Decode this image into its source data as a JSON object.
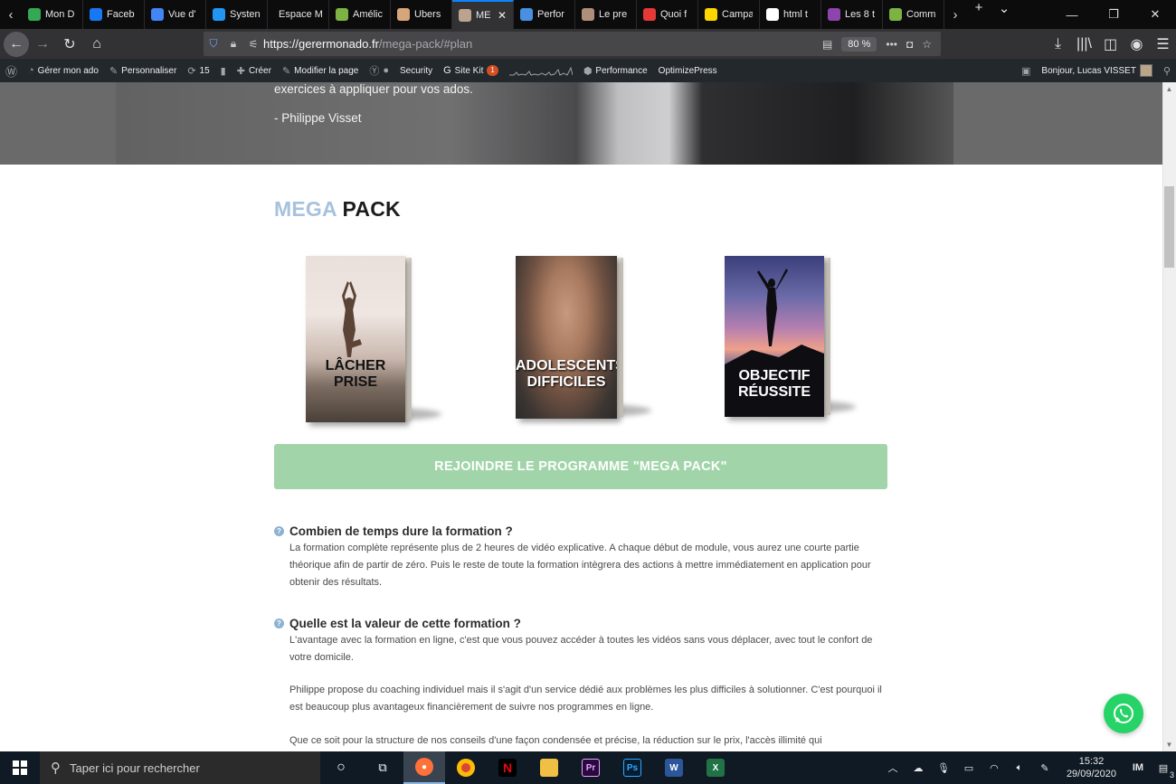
{
  "browser": {
    "tabs": [
      {
        "label": "Mon D",
        "color": "#34a853"
      },
      {
        "label": "Faceb",
        "color": "#1877f2"
      },
      {
        "label": "Vue d'",
        "color": "#4285f4"
      },
      {
        "label": "Systen",
        "color": "#2196f3"
      },
      {
        "label": "Espace Me",
        "color": ""
      },
      {
        "label": "Amélic",
        "color": "#7cb342"
      },
      {
        "label": "Ubers",
        "color": "#d7a57a"
      },
      {
        "label": "ME",
        "color": "#bba390"
      },
      {
        "label": "Perfor",
        "color": "#4a90e2"
      },
      {
        "label": "Le pre",
        "color": "#b08f7a"
      },
      {
        "label": "Quoi f",
        "color": "#e53935"
      },
      {
        "label": "Campa",
        "color": "#ffd600"
      },
      {
        "label": "html t",
        "color": "#ffffff"
      },
      {
        "label": "Les 8 t",
        "color": "#8e44ad"
      },
      {
        "label": "Comm",
        "color": "#7cb342"
      }
    ],
    "url_host": "https://gerermonado.fr",
    "url_path": "/mega-pack/#plan",
    "zoom": "80 %"
  },
  "wpbar": {
    "site": "Gérer mon ado",
    "customize": "Personnaliser",
    "updates": "15",
    "new": "Créer",
    "edit": "Modifier la page",
    "security": "Security",
    "sitekit": "Site Kit",
    "sitekit_badge": "1",
    "performance": "Performance",
    "optimizepress": "OptimizePress",
    "greeting": "Bonjour, Lucas VISSET"
  },
  "hero": {
    "line1": "exercices à appliquer pour vos ados.",
    "author": "- Philippe Visset"
  },
  "section": {
    "title_part1": "MEGA",
    "title_part2": "PACK"
  },
  "books": [
    {
      "title_l1": "LÂCHER",
      "title_l2": "PRISE"
    },
    {
      "title_l1": "ADOLESCENTS",
      "title_l2": "DIFFICILES"
    },
    {
      "title_l1": "OBJECTIF",
      "title_l2": "RÉUSSITE"
    }
  ],
  "cta": {
    "label": "REJOINDRE LE PROGRAMME \"MEGA PACK\""
  },
  "faq": [
    {
      "question": "Combien de temps dure la formation ?",
      "answer": "La formation complète représente plus de 2 heures de vidéo explicative. A chaque début de module, vous aurez une courte partie théorique afin de partir de zéro. Puis le reste de toute la formation intègrera des actions à mettre immédiatement en application pour obtenir des résultats."
    },
    {
      "question": "Quelle est la valeur de cette formation ?",
      "answer_p1": "L'avantage avec la formation en ligne, c'est que vous pouvez accéder à toutes les vidéos sans vous déplacer, avec tout le confort de votre domicile.",
      "answer_p2": "Philippe propose du coaching individuel mais il s'agit d'un service dédié aux problèmes les plus difficiles à solutionner. C'est pourquoi il est beaucoup plus avantageux financièrement de suivre nos programmes en ligne.",
      "answer_p3": "Que ce soit pour la structure de nos conseils d'une façon condensée et précise, la réduction sur le prix, l'accès illimité qui"
    }
  ],
  "taskbar": {
    "search_placeholder": "Taper ici pour rechercher",
    "time": "15:32",
    "date": "29/09/2020",
    "notifications": "3"
  }
}
